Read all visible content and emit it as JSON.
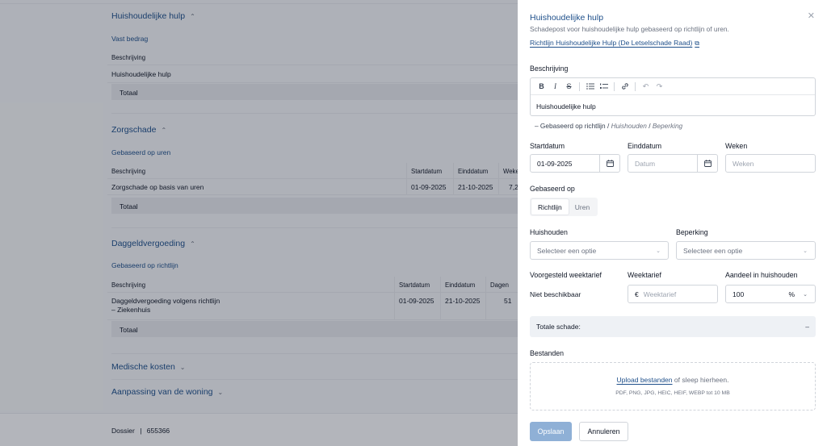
{
  "background": {
    "sections": {
      "huishoudelijk": {
        "title": "Huishoudelijke hulp",
        "sub_link": "Vast bedrag",
        "col_desc": "Beschrijving",
        "row_desc": "Huishoudelijke hulp",
        "total": "Totaal"
      },
      "zorgschade": {
        "title": "Zorgschade",
        "sub_link": "Gebaseerd op uren",
        "cols": [
          "Beschrijving",
          "Startdatum",
          "Einddatum",
          "Weke"
        ],
        "row": [
          "Zorgschade op basis van uren",
          "01-09-2025",
          "21-10-2025",
          "7,2"
        ],
        "total": "Totaal"
      },
      "daggeld": {
        "title": "Daggeldvergoeding",
        "sub_link": "Gebaseerd op richtlijn",
        "cols": [
          "Beschrijving",
          "Startdatum",
          "Einddatum",
          "Dagen"
        ],
        "row_desc_1": "Daggeldvergoeding volgens richtlijn",
        "row_desc_2": "– Ziekenhuis",
        "row_start": "01-09-2025",
        "row_end": "21-10-2025",
        "row_days": "51",
        "total": "Totaal"
      },
      "medisch": {
        "title": "Medische kosten"
      },
      "woning": {
        "title": "Aanpassing van de woning"
      }
    },
    "footer": {
      "label": "Dossier",
      "separator": "|",
      "number": "655366"
    }
  },
  "panel": {
    "title": "Huishoudelijke hulp",
    "subtitle": "Schadepost voor huishoudelijke hulp gebaseerd op richtlijn of uren.",
    "guideline_link": "Richtlijn Huishoudelijke Hulp (De Letselschade Raad)",
    "description": {
      "label": "Beschrijving",
      "toolbar": [
        "B",
        "I",
        "S",
        "bullet-list",
        "numbered-list",
        "link",
        "undo",
        "redo"
      ],
      "value": "Huishoudelijke hulp",
      "meta_prefix": "– Gebaseerd op richtlijn",
      "meta_sep": "/",
      "meta_household": "Huishouden",
      "meta_limitation": "Beperking"
    },
    "start_date": {
      "label": "Startdatum",
      "value": "01-09-2025"
    },
    "end_date": {
      "label": "Einddatum",
      "placeholder": "Datum"
    },
    "weeks": {
      "label": "Weken",
      "placeholder": "Weken"
    },
    "based_on": {
      "label": "Gebaseerd op",
      "options": [
        "Richtlijn",
        "Uren"
      ],
      "selected": "Richtlijn"
    },
    "household": {
      "label": "Huishouden",
      "placeholder": "Selecteer een optie"
    },
    "limitation": {
      "label": "Beperking",
      "placeholder": "Selecteer een optie"
    },
    "suggested_rate": {
      "label": "Voorgesteld weektarief",
      "value": "Niet beschikbaar"
    },
    "week_rate": {
      "label": "Weektarief",
      "currency": "€",
      "placeholder": "Weektarief"
    },
    "share": {
      "label": "Aandeel in huishouden",
      "value": "100",
      "unit": "%"
    },
    "total_damage": {
      "label": "Totale schade:",
      "value": "–"
    },
    "files": {
      "label": "Bestanden",
      "upload_link": "Upload bestanden",
      "upload_rest": " of sleep hierheen.",
      "types": "PDF, PNG, JPG, HEIC, HEIF, WEBP tot 10 MB"
    },
    "save_label": "Opslaan",
    "cancel_label": "Annuleren",
    "colors": {
      "accent": "#1e4f8a",
      "save_button": "#8fb0d6"
    }
  }
}
